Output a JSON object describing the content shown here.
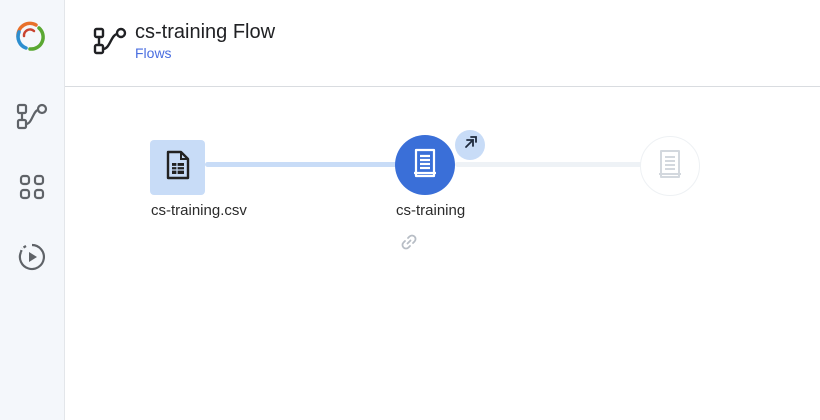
{
  "sidebar": {
    "items": [
      {
        "name": "flow",
        "icon": "flow-icon"
      },
      {
        "name": "apps",
        "icon": "grid-icon"
      },
      {
        "name": "runs",
        "icon": "play-circle-icon"
      }
    ]
  },
  "header": {
    "icon": "flow-icon",
    "title": "cs-training Flow",
    "breadcrumb": "Flows"
  },
  "flow": {
    "nodes": [
      {
        "label": "cs-training.csv",
        "type": "dataset",
        "icon": "document-icon"
      },
      {
        "label": "cs-training",
        "type": "recipe",
        "icon": "recipe-icon"
      },
      {
        "label": "",
        "type": "placeholder",
        "icon": "recipe-icon"
      }
    ],
    "expand_icon": "expand-arrow-icon",
    "link_icon": "link-icon"
  },
  "colors": {
    "accent": "#3a6fd8",
    "accent_light": "#c8dcf7",
    "breadcrumb": "#4a6ee0",
    "sidebar_bg": "#f4f7fb"
  }
}
